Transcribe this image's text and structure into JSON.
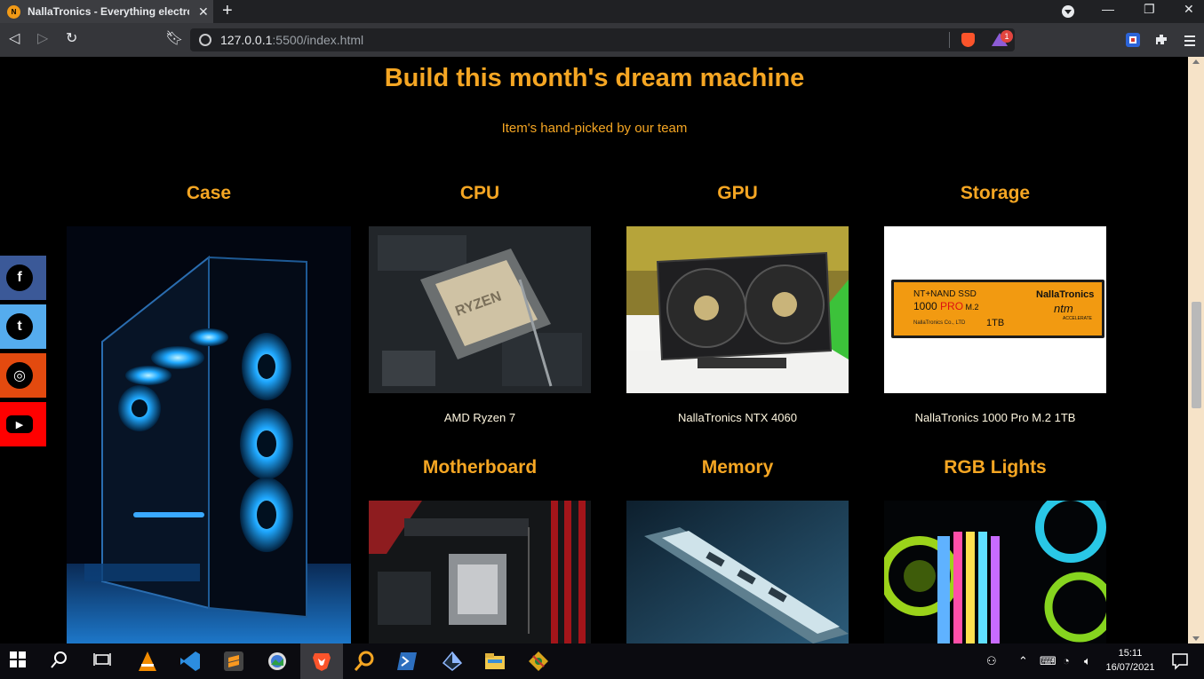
{
  "browser": {
    "tab_title": "NallaTronics - Everything electronics",
    "tab_favicon_text": "N",
    "url_host": "127.0.0.1",
    "url_path": ":5500/index.html",
    "rewards_badge": "1"
  },
  "page": {
    "heading": "Build this month's dream machine",
    "subheading": "Item's hand-picked by our team",
    "categories": [
      {
        "title": "Case",
        "caption": ""
      },
      {
        "title": "CPU",
        "caption": "AMD Ryzen 7"
      },
      {
        "title": "GPU",
        "caption": "NallaTronics NTX 4060"
      },
      {
        "title": "Storage",
        "caption": "NallaTronics 1000 Pro M.2 1TB"
      },
      {
        "title": "Motherboard",
        "caption": ""
      },
      {
        "title": "Memory",
        "caption": ""
      },
      {
        "title": "RGB Lights",
        "caption": ""
      }
    ],
    "storage_label": {
      "line1": "NT+NAND SSD",
      "line2a": "1000 ",
      "line2b": "PRO",
      "line2c": " M.2",
      "brand": "NallaTronics",
      "logo": "ntm",
      "tagline": "ACCELERATE",
      "maker": "NallaTronics Co., LTD",
      "capacity": "1TB"
    },
    "cpu_chip_text": "RYZEN",
    "social": [
      {
        "name": "facebook",
        "glyph": "f",
        "color": "#3b5998"
      },
      {
        "name": "twitter",
        "glyph": "t",
        "color": "#55acee"
      },
      {
        "name": "instagram",
        "glyph": "◎",
        "color": "#e34a0f"
      },
      {
        "name": "youtube",
        "glyph": "▶",
        "color": "#ff0000"
      }
    ]
  },
  "taskbar": {
    "time": "15:11",
    "date": "16/07/2021"
  },
  "colors": {
    "accent": "#f5a623",
    "background": "#000000"
  }
}
